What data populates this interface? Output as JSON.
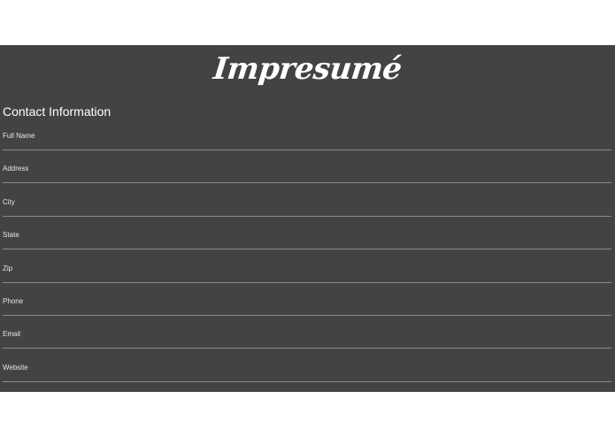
{
  "app": {
    "logo_text": "Impresumé"
  },
  "contact": {
    "title": "Contact Information",
    "fields": [
      {
        "label": "Full Name",
        "value": ""
      },
      {
        "label": "Address",
        "value": ""
      },
      {
        "label": "City",
        "value": ""
      },
      {
        "label": "State",
        "value": ""
      },
      {
        "label": "Zip",
        "value": ""
      },
      {
        "label": "Phone",
        "value": ""
      },
      {
        "label": "Email",
        "value": ""
      },
      {
        "label": "Website",
        "value": ""
      }
    ]
  },
  "colors": {
    "panel_background": "#434343",
    "text": "#ffffff",
    "underline": "#8a8a8a"
  }
}
